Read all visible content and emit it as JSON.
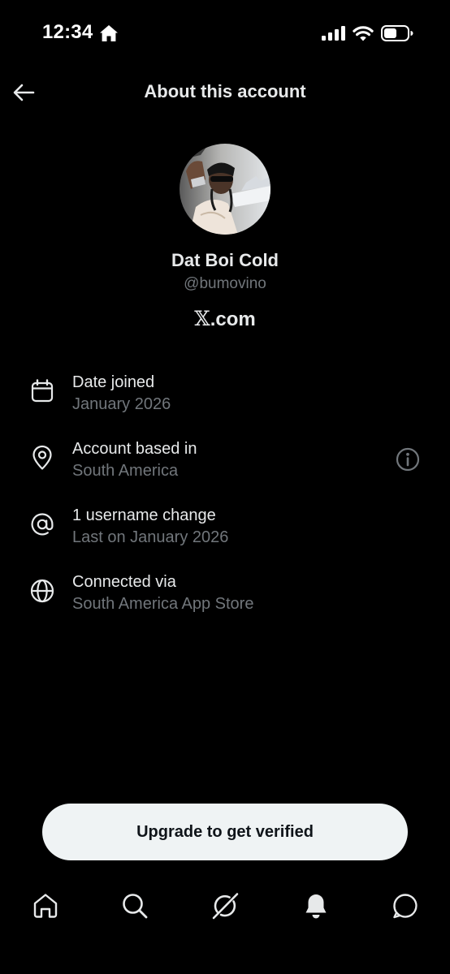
{
  "status_bar": {
    "time": "12:34",
    "icons": [
      "home-icon",
      "signal-icon",
      "wifi-icon",
      "battery-icon"
    ]
  },
  "header": {
    "title": "About this account",
    "back_icon": "arrow-left-icon"
  },
  "profile": {
    "display_name": "Dat Boi Cold",
    "handle": "@bumovino",
    "brand_mark": "𝕏",
    "brand_suffix": ".com"
  },
  "info": {
    "date_joined": {
      "title": "Date joined",
      "value": "January 2026",
      "icon": "calendar-icon"
    },
    "based_in": {
      "title": "Account based in",
      "value": "South America",
      "icon": "location-pin-icon",
      "extra_icon": "info-icon"
    },
    "username": {
      "title": "1 username change",
      "value": "Last on January 2026",
      "icon": "at-sign-icon"
    },
    "connected": {
      "title": "Connected via",
      "value": "South America App Store",
      "icon": "globe-icon"
    }
  },
  "cta": {
    "label": "Upgrade to get verified"
  },
  "tabs": [
    "home-icon",
    "search-icon",
    "grok-icon",
    "notifications-bell-icon",
    "messages-icon"
  ],
  "colors": {
    "background": "#000000",
    "primary_text": "#e7e9ea",
    "secondary_text": "#71767b",
    "button_bg": "#eff3f4",
    "button_text": "#0f1419"
  }
}
